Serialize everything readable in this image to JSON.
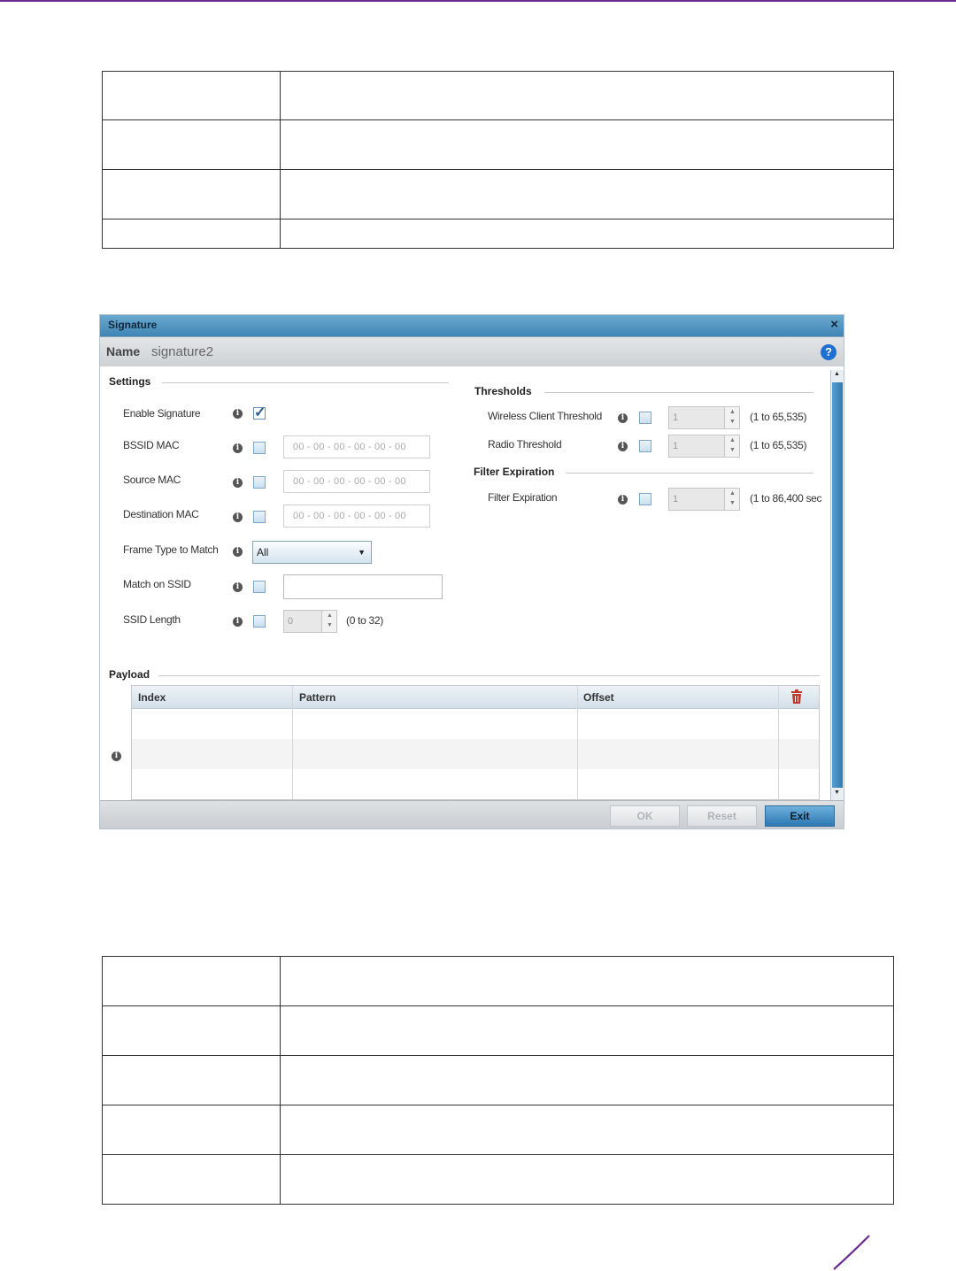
{
  "dialog": {
    "title": "Signature",
    "close_glyph": "×",
    "name_label": "Name",
    "name_value": "signature2",
    "help_glyph": "?",
    "settings": {
      "heading": "Settings",
      "enable_signature": {
        "label": "Enable Signature",
        "checked": true
      },
      "bssid_mac": {
        "label": "BSSID MAC",
        "placeholder": "00 - 00 - 00 - 00 - 00 - 00"
      },
      "source_mac": {
        "label": "Source MAC",
        "placeholder": "00 - 00 - 00 - 00 - 00 - 00"
      },
      "destination_mac": {
        "label": "Destination MAC",
        "placeholder": "00 - 00 - 00 - 00 - 00 - 00"
      },
      "frame_type": {
        "label": "Frame Type to Match",
        "value": "All"
      },
      "match_ssid": {
        "label": "Match on SSID",
        "value": ""
      },
      "ssid_length": {
        "label": "SSID Length",
        "value": "0",
        "range": "(0 to 32)"
      }
    },
    "thresholds": {
      "heading": "Thresholds",
      "wireless_client": {
        "label": "Wireless Client Threshold",
        "value": "1",
        "range": "(1 to 65,535)"
      },
      "radio": {
        "label": "Radio Threshold",
        "value": "1",
        "range": "(1 to 65,535)"
      }
    },
    "filter_expiration": {
      "heading": "Filter Expiration",
      "field": {
        "label": "Filter Expiration",
        "value": "1",
        "range": "(1 to 86,400 sec"
      }
    },
    "payload": {
      "heading": "Payload",
      "columns": [
        "Index",
        "Pattern",
        "Offset"
      ]
    },
    "buttons": {
      "ok": "OK",
      "reset": "Reset",
      "exit": "Exit"
    }
  },
  "icons": {
    "info": "info-icon",
    "checkbox_check": "✓",
    "dropdown": "▼",
    "spin_up": "▲",
    "spin_down": "▼",
    "scroll_up": "▲",
    "scroll_down": "▼",
    "info_glyph": "i"
  },
  "colors": {
    "titlebar": "#3f86b5",
    "primary_button": "#2c78b3",
    "help_icon": "#1f6fd0",
    "trash_icon": "#c0392b",
    "page_accent": "#6b2c91"
  }
}
